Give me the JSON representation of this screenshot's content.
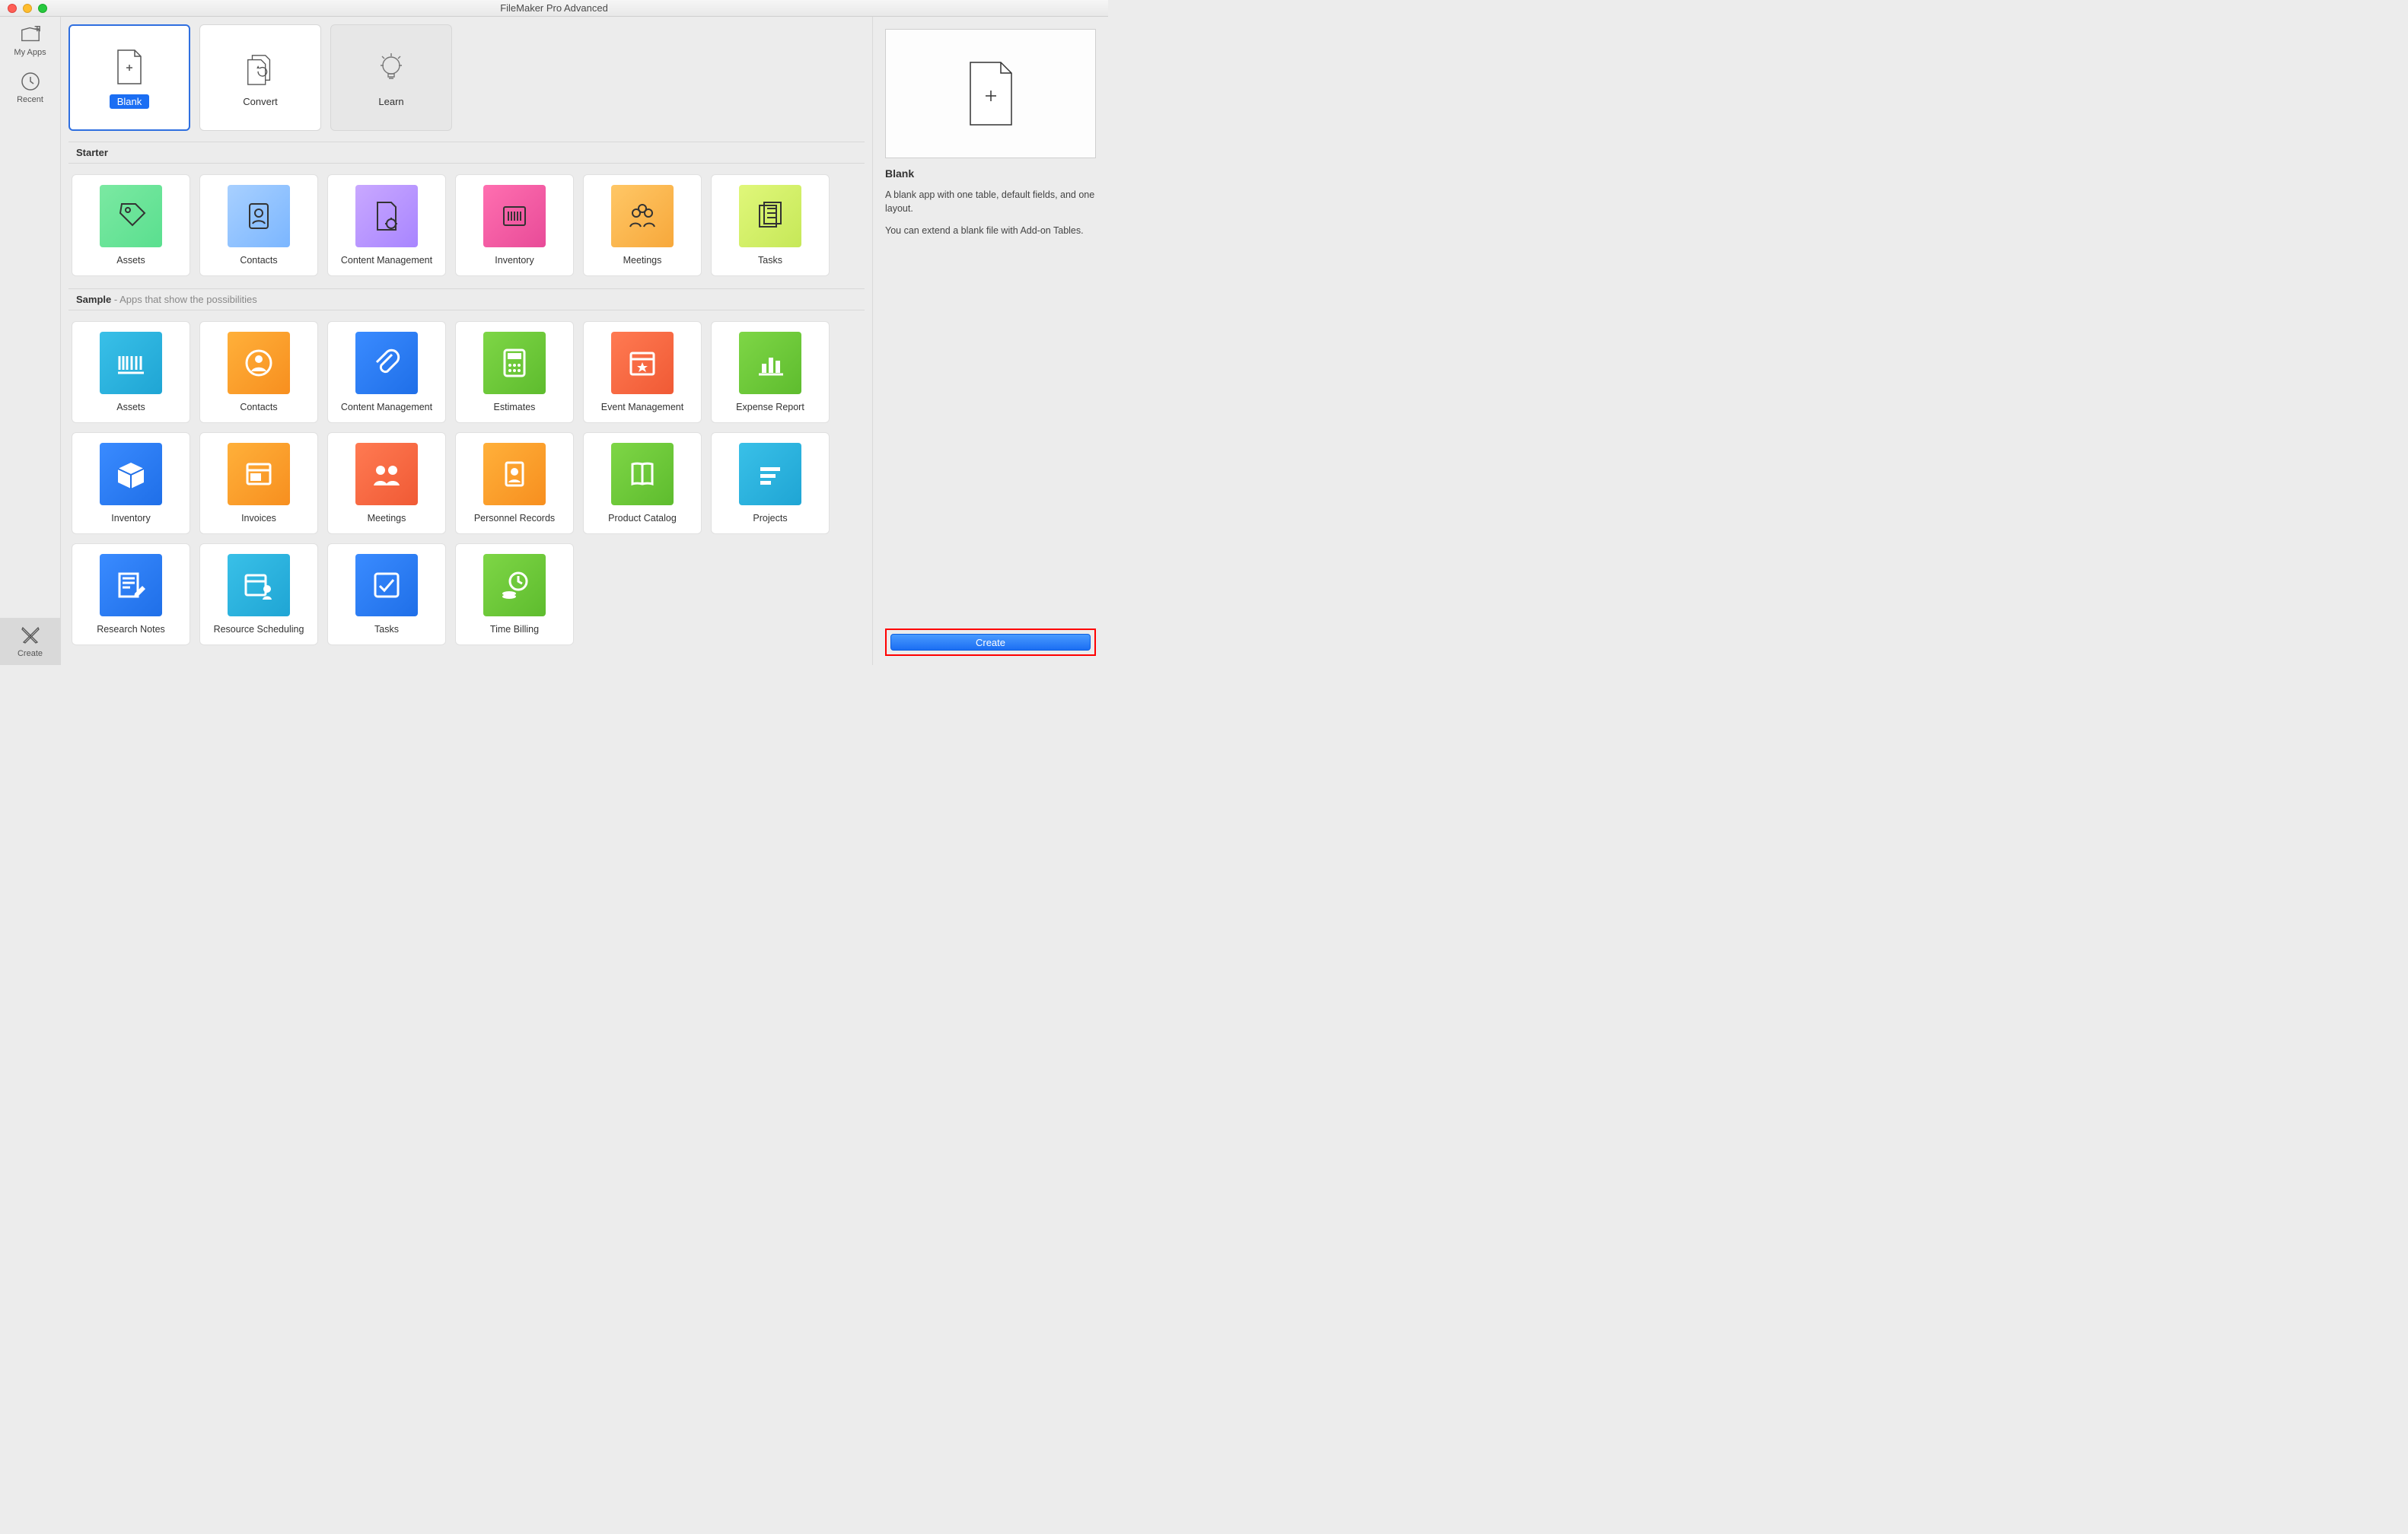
{
  "window": {
    "title": "FileMaker Pro Advanced"
  },
  "sidebar": {
    "items": [
      {
        "label": "My Apps"
      },
      {
        "label": "Recent"
      },
      {
        "label": "Create"
      }
    ]
  },
  "top_tabs": [
    {
      "label": "Blank",
      "selected": true
    },
    {
      "label": "Convert",
      "selected": false
    },
    {
      "label": "Learn",
      "selected": false,
      "disabled": true
    }
  ],
  "sections": {
    "starter": {
      "title": "Starter",
      "items": [
        {
          "label": "Assets",
          "variant": "p-green",
          "icon": "tag"
        },
        {
          "label": "Contacts",
          "variant": "p-blue",
          "icon": "id"
        },
        {
          "label": "Content Management",
          "variant": "p-purple",
          "icon": "docgear"
        },
        {
          "label": "Inventory",
          "variant": "p-pink",
          "icon": "barcode-box"
        },
        {
          "label": "Meetings",
          "variant": "p-orange",
          "icon": "people"
        },
        {
          "label": "Tasks",
          "variant": "p-lime",
          "icon": "checklist-box"
        }
      ]
    },
    "sample": {
      "title": "Sample",
      "subtitle": " - Apps that show the possibilities",
      "items": [
        {
          "label": "Assets",
          "variant": "s-cyan",
          "icon": "barcode"
        },
        {
          "label": "Contacts",
          "variant": "s-orange",
          "icon": "person-circle"
        },
        {
          "label": "Content Management",
          "variant": "s-blue",
          "icon": "clip"
        },
        {
          "label": "Estimates",
          "variant": "s-green",
          "icon": "calc"
        },
        {
          "label": "Event Management",
          "variant": "s-red",
          "icon": "calendar-star"
        },
        {
          "label": "Expense Report",
          "variant": "s-green",
          "icon": "barchart"
        },
        {
          "label": "Inventory",
          "variant": "s-blue",
          "icon": "box3d"
        },
        {
          "label": "Invoices",
          "variant": "s-orange",
          "icon": "window"
        },
        {
          "label": "Meetings",
          "variant": "s-red",
          "icon": "people-fill"
        },
        {
          "label": "Personnel Records",
          "variant": "s-orange",
          "icon": "id-card"
        },
        {
          "label": "Product Catalog",
          "variant": "s-green",
          "icon": "book"
        },
        {
          "label": "Projects",
          "variant": "s-cyan",
          "icon": "lines"
        },
        {
          "label": "Research Notes",
          "variant": "s-blue",
          "icon": "note-pencil"
        },
        {
          "label": "Resource Scheduling",
          "variant": "s-cyan",
          "icon": "calendar-person"
        },
        {
          "label": "Tasks",
          "variant": "s-blue",
          "icon": "check-box"
        },
        {
          "label": "Time Billing",
          "variant": "s-green",
          "icon": "clock-coins"
        }
      ]
    }
  },
  "detail": {
    "title": "Blank",
    "desc1": "A blank app with one table, default fields, and one layout.",
    "desc2": "You can extend a blank file with Add-on Tables.",
    "create_label": "Create"
  }
}
